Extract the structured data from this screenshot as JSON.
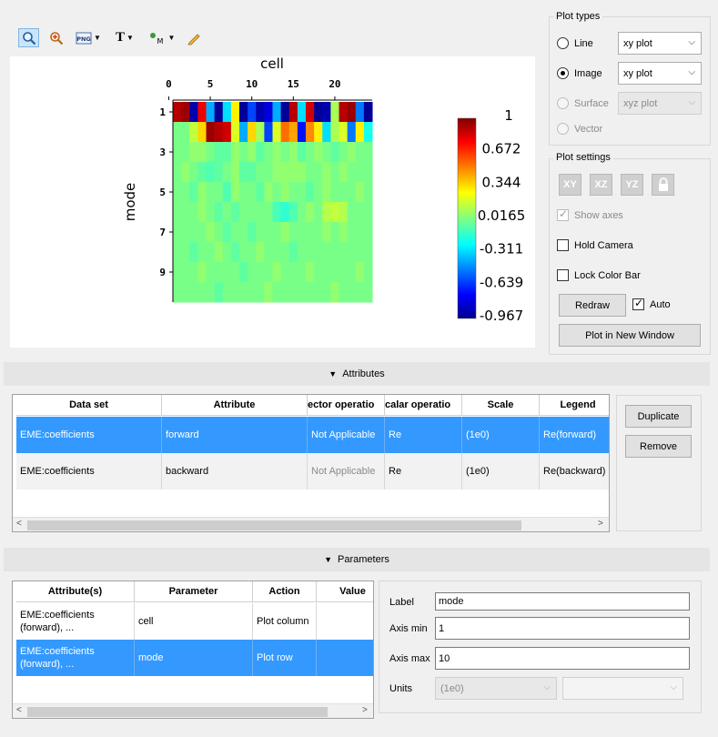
{
  "toolbar": {
    "buttons": [
      {
        "icon": "zoom-icon",
        "selected": true
      },
      {
        "icon": "zoom-fit-icon",
        "selected": false
      },
      {
        "icon": "png-export-icon",
        "label": "PNG"
      },
      {
        "icon": "text-icon",
        "label": "T"
      },
      {
        "icon": "marker-icon",
        "label": "M"
      },
      {
        "icon": "pencil-icon"
      }
    ]
  },
  "plot": {
    "xlabel": "cell",
    "ylabel": "mode",
    "xticks": [
      "0",
      "5",
      "10",
      "15",
      "20"
    ],
    "yticks": [
      "1",
      "3",
      "5",
      "7",
      "9"
    ],
    "colorbar_ticks": [
      "1",
      "0.672",
      "0.344",
      "0.0165",
      "-0.311",
      "-0.639",
      "-0.967"
    ]
  },
  "chart_data": {
    "type": "heatmap",
    "x_range": [
      1,
      24
    ],
    "y_range": [
      1,
      10
    ],
    "color_range": [
      -0.967,
      1
    ],
    "colorscale": "jet",
    "rows": [
      [
        0.9,
        0.95,
        -0.9,
        0.8,
        -0.4,
        -0.95,
        -0.3,
        0.3,
        -0.95,
        -0.6,
        -0.9,
        -0.8,
        -0.4,
        -0.95,
        0.9,
        -0.3,
        0.85,
        -0.95,
        -0.9,
        0.1,
        0.9,
        0.95,
        -0.5,
        -0.95
      ],
      [
        0.0,
        0.0,
        0.15,
        0.35,
        0.95,
        0.9,
        0.85,
        0.2,
        -0.4,
        0.35,
        0.1,
        -0.6,
        0.2,
        0.55,
        0.45,
        -0.7,
        0.5,
        0.3,
        -0.3,
        0.1,
        0.2,
        -0.5,
        0.3,
        -0.2
      ],
      [
        0.0,
        0.0,
        0.05,
        0.05,
        0.0,
        -0.05,
        -0.05,
        0.05,
        0.0,
        0.05,
        -0.05,
        0.0,
        0.05,
        0.0,
        0.05,
        -0.05,
        0.0,
        0.05,
        0.0,
        -0.05,
        0.0,
        0.05,
        0.0,
        0.0
      ],
      [
        0.0,
        0.05,
        0.0,
        -0.05,
        -0.08,
        -0.05,
        0.0,
        0.05,
        -0.05,
        -0.05,
        0.0,
        0.0,
        0.05,
        0.05,
        0.05,
        0.05,
        0.0,
        0.0,
        0.05,
        0.0,
        0.05,
        0.0,
        0.0,
        0.0
      ],
      [
        0.0,
        0.0,
        -0.05,
        0.05,
        0.0,
        0.0,
        -0.08,
        0.05,
        0.0,
        0.0,
        -0.05,
        0.05,
        0.0,
        0.05,
        0.0,
        0.0,
        -0.05,
        0.0,
        0.05,
        0.0,
        0.0,
        0.0,
        0.05,
        0.0
      ],
      [
        0.0,
        0.0,
        0.0,
        0.05,
        0.0,
        -0.05,
        0.0,
        -0.05,
        0.0,
        0.0,
        0.0,
        0.0,
        -0.1,
        -0.15,
        -0.08,
        0.0,
        0.05,
        0.0,
        0.12,
        0.15,
        0.12,
        0.0,
        0.0,
        0.0
      ],
      [
        0.0,
        0.0,
        0.0,
        0.0,
        0.05,
        0.0,
        -0.05,
        0.0,
        0.0,
        -0.05,
        0.0,
        0.0,
        0.0,
        0.05,
        0.0,
        0.0,
        0.0,
        0.0,
        0.05,
        0.0,
        0.05,
        0.0,
        0.0,
        0.0
      ],
      [
        0.0,
        0.0,
        -0.05,
        0.0,
        0.0,
        0.05,
        0.0,
        -0.05,
        0.0,
        0.0,
        0.05,
        0.0,
        0.0,
        0.0,
        -0.05,
        0.0,
        0.0,
        0.0,
        0.0,
        0.0,
        0.0,
        0.0,
        0.0,
        0.0
      ],
      [
        0.0,
        0.0,
        0.0,
        0.05,
        0.0,
        0.0,
        0.0,
        0.0,
        -0.05,
        0.0,
        0.0,
        0.0,
        0.05,
        0.0,
        0.0,
        0.0,
        0.05,
        0.0,
        0.0,
        0.0,
        0.0,
        0.0,
        0.05,
        0.0
      ],
      [
        0.0,
        0.0,
        0.0,
        0.0,
        0.0,
        -0.05,
        0.0,
        0.0,
        0.0,
        0.0,
        0.0,
        0.05,
        0.0,
        0.0,
        0.0,
        0.0,
        0.0,
        0.0,
        0.0,
        0.05,
        0.0,
        0.0,
        0.0,
        0.0
      ]
    ]
  },
  "plot_types": {
    "title": "Plot types",
    "options": [
      {
        "label": "Line",
        "checked": false,
        "disabled": false,
        "combo": "xy plot"
      },
      {
        "label": "Image",
        "checked": true,
        "disabled": false,
        "combo": "xy plot"
      },
      {
        "label": "Surface",
        "checked": false,
        "disabled": true,
        "combo": "xyz plot"
      },
      {
        "label": "Vector",
        "checked": false,
        "disabled": true,
        "combo": ""
      }
    ]
  },
  "plot_settings": {
    "title": "Plot settings",
    "view_buttons": [
      "XY",
      "XZ",
      "YZ"
    ],
    "show_axes": "Show axes",
    "hold_camera": "Hold Camera",
    "lock_color_bar": "Lock Color Bar",
    "redraw": "Redraw",
    "auto": "Auto",
    "plot_new_window": "Plot in New Window"
  },
  "attributes": {
    "section_title": "Attributes",
    "headers": [
      "Data set",
      "Attribute",
      "ector operatio",
      "calar operatio",
      "Scale",
      "Legend"
    ],
    "rows": [
      [
        "EME:coefficients",
        "forward",
        "Not Applicable",
        "Re",
        "(1e0)",
        "Re(forward)"
      ],
      [
        "EME:coefficients",
        "backward",
        "Not Applicable",
        "Re",
        "(1e0)",
        "Re(backward)"
      ]
    ],
    "duplicate": "Duplicate",
    "remove": "Remove"
  },
  "parameters": {
    "section_title": "Parameters",
    "headers": [
      "Attribute(s)",
      "Parameter",
      "Action",
      "Value"
    ],
    "rows": [
      [
        "EME:coefficients (forward), ...",
        "cell",
        "Plot column",
        ""
      ],
      [
        "EME:coefficients (forward), ...",
        "mode",
        "Plot row",
        ""
      ]
    ],
    "label_label": "Label",
    "label_value": "mode",
    "axis_min_label": "Axis min",
    "axis_min_value": "1",
    "axis_max_label": "Axis max",
    "axis_max_value": "10",
    "units_label": "Units",
    "units_value": "(1e0)"
  }
}
